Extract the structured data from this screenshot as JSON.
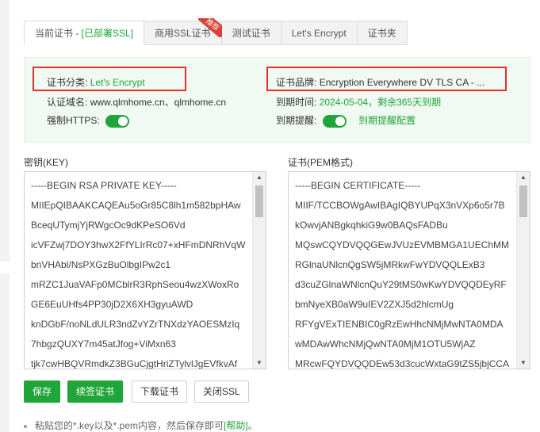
{
  "tabs": [
    {
      "label": "当前证书 - ",
      "suffix": "[已部署SSL]"
    },
    {
      "label": "商用SSL证书",
      "badge": "推荐"
    },
    {
      "label": "测试证书"
    },
    {
      "label": "Let's Encrypt"
    },
    {
      "label": "证书夹"
    }
  ],
  "info": {
    "category_label": "证书分类:",
    "category_value": "Let's Encrypt",
    "brand_label": "证书品牌:",
    "brand_value": "Encryption Everywhere DV TLS CA - ...",
    "domain_label": "认证域名:",
    "domain_value": "www.qlmhome.cn、qlmhome.cn",
    "expire_label": "到期时间:",
    "expire_value": "2024-05-04，剩余365天到期",
    "https_label": "强制HTTPS:",
    "https_on": true,
    "remind_label": "到期提醒:",
    "remind_on": true,
    "remind_config_link": "到期提醒配置"
  },
  "key": {
    "label": "密钥(KEY)",
    "lines": [
      "-----BEGIN RSA PRIVATE KEY-----",
      "MIIEpQIBAAKCAQEAu5oGr85C8lh1m582bpHAw",
      "BceqUTymjYjRWgcOc9dKPeSO6Vd",
      "icVFZwj7DOY3hwX2FfYLIrRc07+xHFmDNRhVqW",
      "bnVHAbl/NsPXGzBuOlbgIPw2c1",
      "mRZC1JuaVAFp0MCblrR3RphSeou4wzXWoxRo",
      "GE6EuUHfs4PP30jD2X6XH3gyuAWD",
      "knDGbF/noNLdULR3ndZvYZrTNXdzYAOESMzIq",
      "7hbgzQUXY7m45atJfog+ViMxn63",
      "tjk7cwHBQVRmdkZ3BGuCjgtHriZTylvlJgEVfkvAf"
    ]
  },
  "cert": {
    "label": "证书(PEM格式)",
    "lines": [
      "-----BEGIN CERTIFICATE-----",
      "MIIF/TCCBOWgAwIBAgIQBYUPqX3nVXp6o5r7B",
      "kOwvjANBgkqhkiG9w0BAQsFADBu",
      "MQswCQYDVQQGEwJVUzEVMBMGA1UEChMM",
      "RGlnaUNlcnQgSW5jMRkwFwYDVQQLExB3",
      "d3cuZGlnaWNlcnQuY29tMS0wKwYDVQQDEyRF",
      "bmNyeXB0aW9uIEV2ZXJ5d2hlcmUg",
      "RFYgVExTIENBIC0gRzEwHhcNMjMwNTA0MDA",
      "wMDAwWhcNMjQwNTA0MjM1OTU5WjAZ",
      "MRcwFQYDVQQDEw53d3cucWxtaG9tZS5jbjCCA"
    ]
  },
  "buttons": {
    "save": "保存",
    "renew": "续签证书",
    "download": "下载证书",
    "close_ssl": "关闭SSL"
  },
  "tip": {
    "text": "粘贴您的*.key以及*.pem内容，然后保存即可",
    "help": "[帮助]",
    "end": "。"
  },
  "colors": {
    "accent": "#20a53a",
    "highlight_border": "#e5302b",
    "info_bg": "#f1f9f3",
    "badge": "#d9443a"
  }
}
